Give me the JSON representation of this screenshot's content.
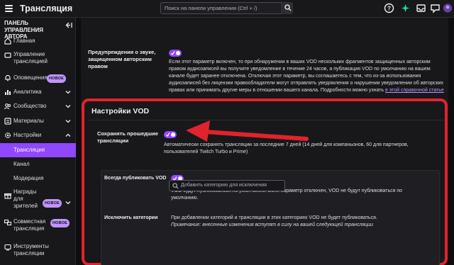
{
  "topbar": {
    "title": "Трансляция",
    "search_placeholder": "Поиск на панели управления (Ctrl + /)"
  },
  "sidebar": {
    "header": "ПАНЕЛЬ УПРАВЛЕНИЯ АВТОРА",
    "items": [
      {
        "label": "Главная",
        "icon": "home-icon"
      },
      {
        "label": "Управление трансляцией",
        "icon": "stream-manager-icon"
      },
      {
        "label": "Оповещения",
        "icon": "alerts-icon",
        "badge": "НОВОЕ"
      },
      {
        "label": "Аналитика",
        "icon": "analytics-icon"
      },
      {
        "label": "Сообщество",
        "icon": "community-icon"
      },
      {
        "label": "Материалы",
        "icon": "content-icon"
      },
      {
        "label": "Настройки",
        "icon": "settings-icon"
      },
      {
        "label": "Награды для зрителей",
        "icon": "rewards-icon",
        "badge": "НОВОЕ"
      },
      {
        "label": "Совместная трансляция",
        "icon": "collab-icon",
        "badge": "НОВОЕ"
      },
      {
        "label": "Инструменты трансляции",
        "icon": "tools-icon"
      }
    ],
    "sub_items": [
      "Трансляция",
      "Канал",
      "Модерация"
    ]
  },
  "copyright": {
    "label": "Предупреждения о звуке, защищенном авторским правом",
    "desc": "Если этот параметр включен, то при обнаружении в ваших VOD нескольких фрагментов защищенных авторским правом аудиозаписей вы получите уведомление в течение 24 часов, а публикация VOD по умолчанию на вашем канале будет заранее отключена. Отключая этот параметр, вы соглашаетесь с тем, что из-за использования аудиозаписей без лицензии правообладатели могут отправлять уведомления о нарушении уведомлении об авторских правах или принимать другие меры в отношении вашего канала. Подробности можно узнать ",
    "link": "в этой справочной статье"
  },
  "vod": {
    "title": "Настройки VOD",
    "store_label": "Сохранять прошедшие трансляции",
    "store_desc": "Автоматически сохранять трансляции за последние 7 дней (14 дней для компаньонов, 60 для партнеров, пользователей Twitch Turbo и Prime)",
    "publish_label": "Всегда публиковать VOD",
    "publish_desc": "VOD будут публиковаться по умолчанию. Если параметр отключен, VOD не будут публиковаться по умолчанию.",
    "exclude_label": "Исключить категории",
    "exclude_desc": "При добавлении категорий и трансляции в этих категориях VOD не будет публиковаться.",
    "exclude_note": "Примечание: внесенные изменения вступят в силу на вашей следующей трансляции",
    "exclude_placeholder": "Добавить категорию для исключения"
  },
  "colors": {
    "accent": "#9147ff",
    "highlight": "#e1232c",
    "badge": "#bf94ff"
  }
}
